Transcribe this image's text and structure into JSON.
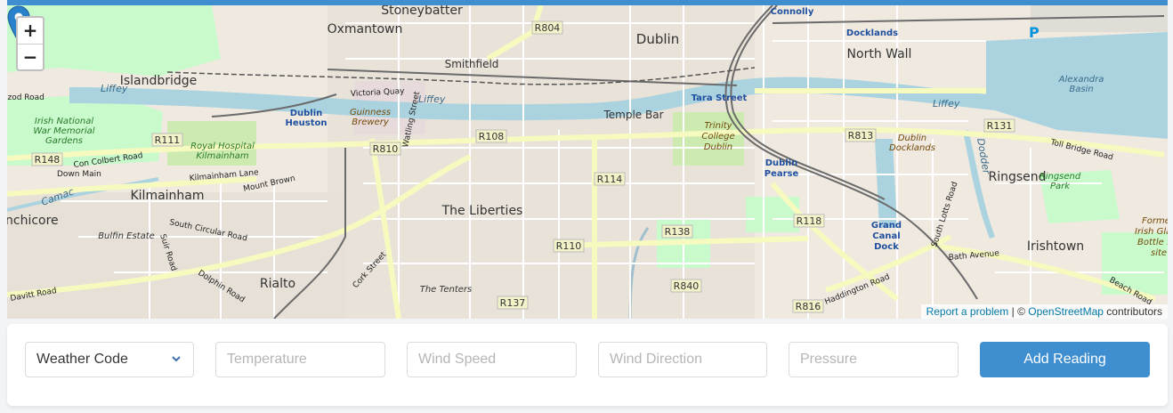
{
  "map": {
    "zoom_in": "+",
    "zoom_out": "−",
    "attribution": {
      "report": "Report a problem",
      "sep": " | © ",
      "osm": "OpenStreetMap",
      "contributors": " contributors"
    },
    "labels": {
      "stoneybatter": "Stoneybatter",
      "oxmantown": "Oxmantown",
      "dublin": "Dublin",
      "connolly": "Connolly",
      "docklands": "Docklands",
      "northwall": "North Wall",
      "smithfield": "Smithfield",
      "islandbridge": "Islandbridge",
      "dublinheuston1": "Dublin",
      "dublinheuston2": "Heuston",
      "guinness1": "Guinness",
      "guinness2": "Brewery",
      "templebar": "Temple Bar",
      "tarastreet": "Tara Street",
      "liffey1": "Liffey",
      "liffey2": "Liffey",
      "liffey3": "Liffey",
      "irishnat1": "Irish National",
      "irishnat2": "War Memorial",
      "irishnat3": "Gardens",
      "royalhosp1": "Royal Hospital",
      "royalhosp2": "Kilmainham",
      "trinity1": "Trinity",
      "trinity2": "College",
      "trinity3": "Dublin",
      "dublindocklands1": "Dublin",
      "dublindocklands2": "Docklands",
      "alexandra1": "Alexandra",
      "alexandra2": "Basin",
      "kilmainham": "Kilmainham",
      "theliberties": "The Liberties",
      "dublinpearse1": "Dublin",
      "dublinpearse2": "Pearse",
      "ringsend": "Ringsend",
      "ringsendpark1": "Ringsend",
      "ringsendpark2": "Park",
      "irishtown": "Irishtown",
      "inchicore": "nchicore",
      "bulfin": "Bulfin Estate",
      "rialto": "Rialto",
      "thetenters": "The Tenters",
      "grandcanal1": "Grand",
      "grandcanal2": "Canal",
      "grandcanal3": "Dock",
      "former1": "Forme",
      "former2": "Irish Gla",
      "former3": "Bottle fac",
      "former4": "site",
      "r804": "R804",
      "r108": "R108",
      "r111": "R111",
      "r148": "R148",
      "r810": "R810",
      "r114": "R114",
      "r813": "R813",
      "r131": "R131",
      "r118": "R118",
      "r138": "R138",
      "r110": "R110",
      "r840": "R840",
      "r137": "R137",
      "r816": "R816",
      "victoriaquay": "Victoria Quay",
      "wattling": "Watling Street",
      "conolbert": "Con Colbert Road",
      "downmain": "Down Main",
      "kilmainhamlane": "Kilmainham Lane",
      "mountbrown": "Mount Brown",
      "southcircular": "South Circular Road",
      "suirroad": "Suir Road",
      "dolphinroad": "Dolphin Road",
      "davittroad": "Davitt Road",
      "corkstreet": "Cork Street",
      "haddington": "Haddington Road",
      "bathavenue": "Bath Avenue",
      "beachroad": "Beach Road",
      "southlotts": "South Lotts Road",
      "tollbridge": "Toll Bridge Road",
      "dodder": "Dodder",
      "camac": "Camac",
      "izodroad": "izod Road",
      "p": "P"
    }
  },
  "form": {
    "weather_code": "Weather Code",
    "temperature": "Temperature",
    "wind_speed": "Wind Speed",
    "wind_direction": "Wind Direction",
    "pressure": "Pressure",
    "add_button": "Add Reading"
  },
  "colors": {
    "accent": "#3e8ed0",
    "marker": "#2a81cb",
    "water": "#aad3df",
    "park": "#c8facc",
    "road_major": "#f7fabf"
  }
}
